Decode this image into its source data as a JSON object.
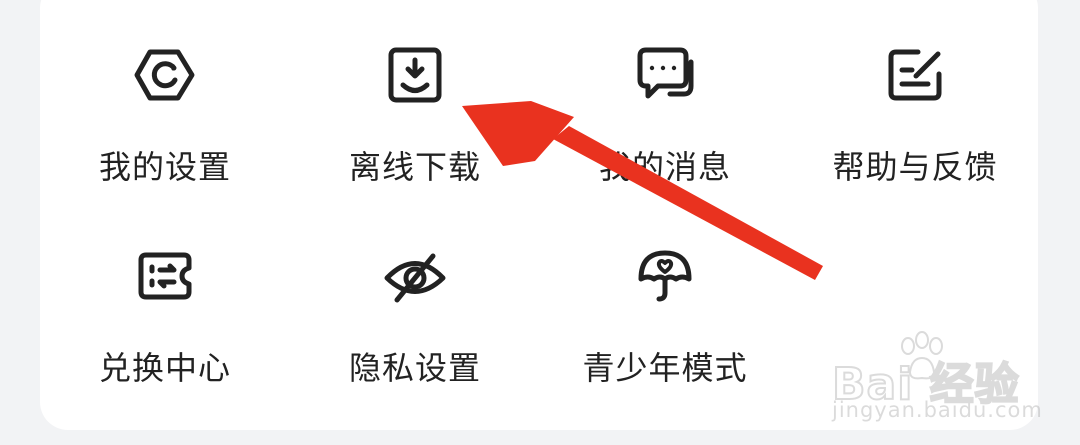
{
  "menu": {
    "items": [
      {
        "label": "我的设置",
        "icon": "settings-icon"
      },
      {
        "label": "离线下载",
        "icon": "download-tray-icon"
      },
      {
        "label": "我的消息",
        "icon": "chat-bubbles-icon"
      },
      {
        "label": "帮助与反馈",
        "icon": "feedback-edit-icon"
      },
      {
        "label": "兑换中心",
        "icon": "ticket-exchange-icon"
      },
      {
        "label": "隐私设置",
        "icon": "eye-off-icon"
      },
      {
        "label": "青少年模式",
        "icon": "teen-umbrella-icon"
      }
    ]
  },
  "annotation": {
    "arrow_color": "#e9321f",
    "points_to": "离线下载"
  },
  "watermark": {
    "brand": "Bai 经验",
    "url": "jingyan.baidu.com"
  },
  "colors": {
    "background": "#f2f3f5",
    "card": "#ffffff",
    "text": "#222222",
    "icon_stroke": "#222222"
  }
}
